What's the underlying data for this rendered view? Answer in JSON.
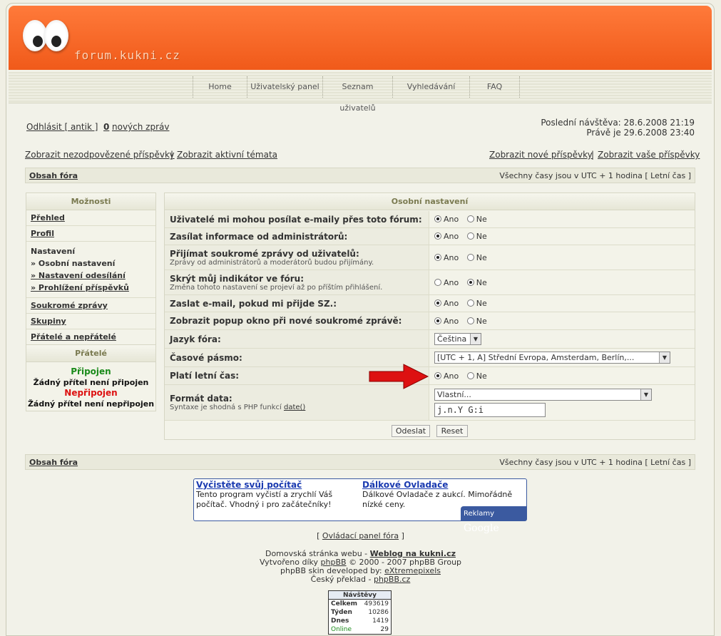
{
  "brand": "forum.kukni.cz",
  "nav": [
    "Home",
    "Uživatelský panel",
    "Seznam uživatelů",
    "Vyhledávání",
    "FAQ"
  ],
  "user": {
    "logout": "Odhlásit [ antik ]",
    "pm_count": "0",
    "pm_label": "nových zpráv",
    "last_visit": "Poslední návštěva: 28.6.2008 21:19",
    "now": "Právě je 29.6.2008 23:40"
  },
  "quick": {
    "unanswered": "Zobrazit nezodpovězené příspěvky",
    "active": "Zobrazit aktivní témata",
    "new_posts": "Zobrazit nové příspěvky",
    "your_posts": "Zobrazit vaše příspěvky",
    "sep": "|"
  },
  "breadcrumb": {
    "index": "Obsah fóra",
    "tz": "Všechny časy jsou v UTC + 1 hodina [ Letní čas ]"
  },
  "sidebar": {
    "title": "Možnosti",
    "items": [
      "Přehled",
      "Profil"
    ],
    "settings_title": "Nastavení",
    "settings_items": [
      "» Osobní nastavení",
      "» Nastavení odesílání",
      "» Prohlížení příspěvků"
    ],
    "items2": [
      "Soukromé zprávy",
      "Skupiny",
      "Přátelé a nepřátelé"
    ]
  },
  "friends": {
    "title": "Přátelé",
    "online": "Připojen",
    "online_none": "Žádný přítel není připojen",
    "offline": "Nepřipojen",
    "offline_none": "Žádný přítel není nepřipojen",
    "online_color": "#1a8a1a",
    "offline_color": "#dd1111"
  },
  "panel": {
    "title": "Osobní nastavení",
    "yes": "Ano",
    "no": "Ne",
    "rows": [
      {
        "label": "Uživatelé mi mohou posílat e-maily přes toto fórum:",
        "hint": "",
        "value": "yes"
      },
      {
        "label": "Zasílat informace od administrátorů:",
        "hint": "",
        "value": "yes"
      },
      {
        "label": "Přijímat soukromé zprávy od uživatelů:",
        "hint": "Zprávy od administrátorů a moderátorů budou přijímány.",
        "value": "yes"
      },
      {
        "label": "Skrýt můj indikátor ve fóru:",
        "hint": "Změna tohoto nastavení se projeví až po příštím přihlášení.",
        "value": "no"
      },
      {
        "label": "Zaslat e-mail, pokud mi přijde SZ.:",
        "hint": "",
        "value": "yes"
      },
      {
        "label": "Zobrazit popup okno při nové soukromé zprávě:",
        "hint": "",
        "value": "yes"
      },
      {
        "label": "Jazyk fóra:",
        "hint": "",
        "value": "Čeština"
      },
      {
        "label": "Časové pásmo:",
        "hint": "",
        "value": "[UTC + 1, A] Střední Evropa, Amsterdam, Berlín,..."
      },
      {
        "label": "Platí letní čas:",
        "hint": "",
        "value": "yes"
      },
      {
        "label": "Formát data:",
        "hint": "Syntaxe je shodná s PHP funkcí",
        "hint_link": "date()",
        "select": "Vlastní...",
        "input": "j.n.Y G:i"
      }
    ],
    "submit": "Odeslat",
    "reset": "Reset"
  },
  "ads": [
    {
      "title": "Vyčistěte svůj počítač",
      "text": "Tento program vyčistí a zrychlí Váš počítač. Vhodný i pro začátečníky!"
    },
    {
      "title": "Dálkové Ovladače",
      "text": "Dálkové Ovladače z aukcí. Mimořádně nízké ceny."
    }
  ],
  "ads_label": "Reklamy",
  "ads_brand": "Google",
  "footer": {
    "admin_link": "Ovládací panel fóra",
    "home_prefix": "Domovská stránka webu -",
    "home_link": "Weblog na kukni.cz",
    "created_prefix": "Vytvořeno díky",
    "created_link": "phpBB",
    "created_suffix": "© 2000 - 2007 phpBB Group",
    "skin_prefix": "phpBB skin developed by:",
    "skin_link": "eXtremepixels",
    "cz_prefix": "Český překlad -",
    "cz_link": "phpBB.cz"
  },
  "counter": {
    "title": "Návštěvy",
    "rows": [
      {
        "label": "Celkem",
        "value": "493619"
      },
      {
        "label": "Týden",
        "value": "10286"
      },
      {
        "label": "Dnes",
        "value": "1419"
      },
      {
        "label": "Online",
        "value": "29"
      }
    ]
  },
  "colors": {
    "header": "#f26a28",
    "arrow": "#dd1111",
    "ad_title": "#1a3ab0"
  }
}
